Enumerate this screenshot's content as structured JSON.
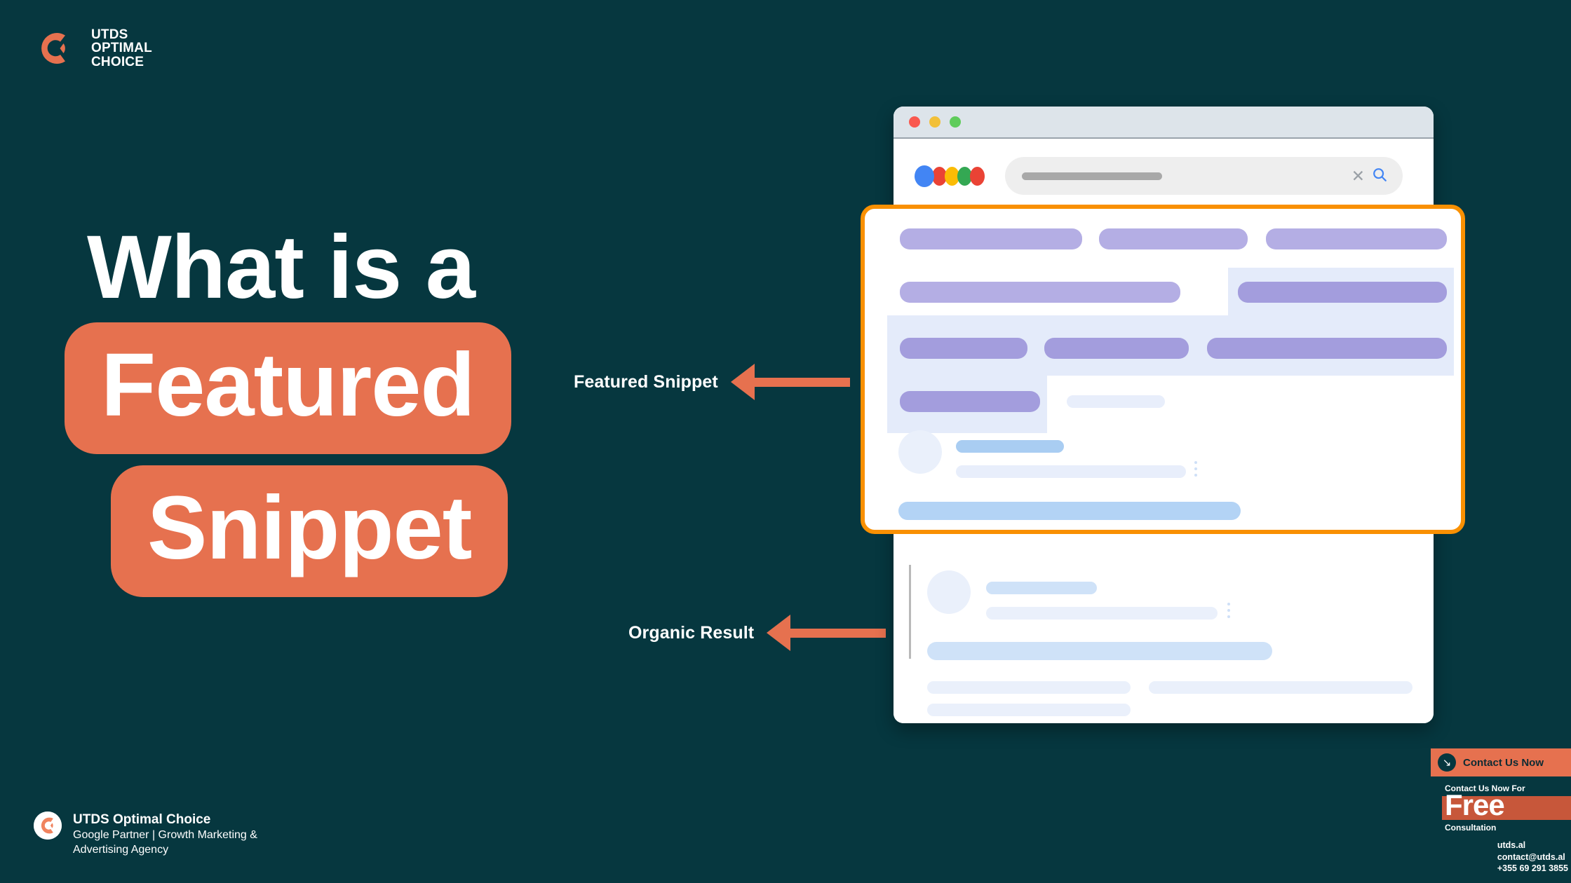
{
  "brand": {
    "top_lockup_lines": [
      "UTDS",
      "OPTIMAL",
      "CHOICE"
    ],
    "logo_icon": "utds-circle-logo-icon",
    "accent_color": "#e6714f",
    "background_color": "#06373f"
  },
  "headline": {
    "line1": "What is a",
    "line2": "Featured",
    "line3": "Snippet"
  },
  "callouts": [
    {
      "label": "Featured Snippet",
      "arrow_icon": "arrow-left-icon"
    },
    {
      "label": "Organic Result",
      "arrow_icon": "arrow-left-icon"
    }
  ],
  "browser": {
    "traffic_lights": [
      "close-red",
      "minimize-yellow",
      "maximize-green"
    ],
    "search": {
      "engine_logo": "google-dots-logo-icon",
      "value": "",
      "placeholder": "",
      "clear_icon": "close-icon",
      "search_icon": "search-icon"
    },
    "snippet_highlight_color": "#f99002"
  },
  "footer": {
    "logo_icon": "utds-circle-logo-icon",
    "name": "UTDS Optimal Choice",
    "tagline": "Google Partner | Growth Marketing & Advertising Agency"
  },
  "contact": {
    "button_label": "Contact Us Now",
    "button_icon": "arrow-down-right-icon",
    "promo_top": "Contact Us Now For",
    "promo_big": "Free",
    "promo_bottom": "Consultation",
    "website": "utds.al",
    "email": "contact@utds.al",
    "phone": "+355 69 291 3855"
  }
}
